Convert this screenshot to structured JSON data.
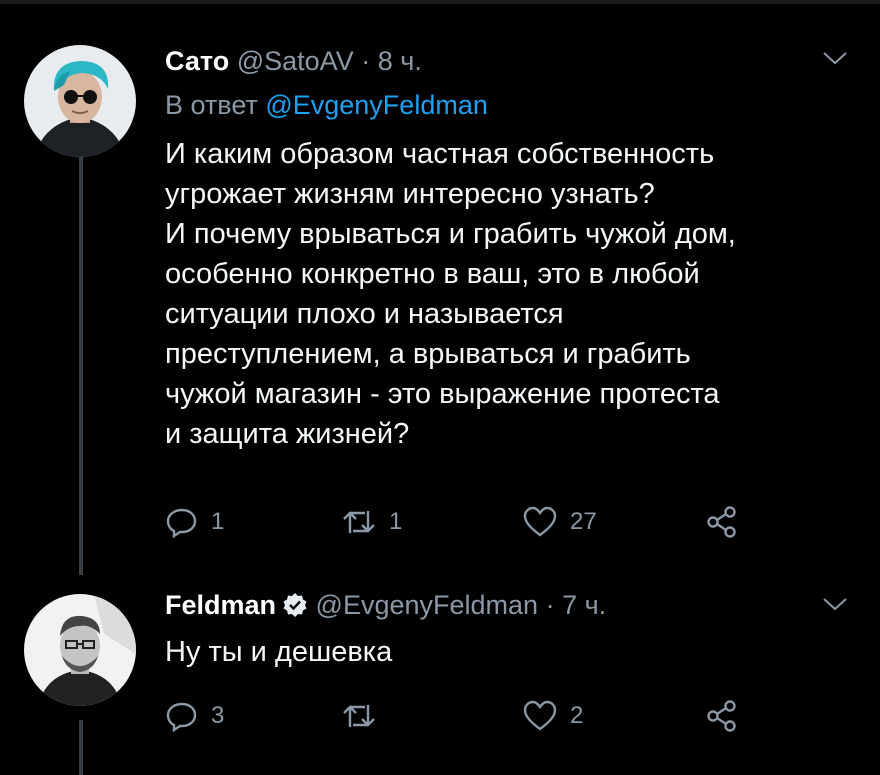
{
  "tweets": [
    {
      "name": "Сато",
      "handle": "@SatoAV",
      "dot": "·",
      "time": "8 ч.",
      "reply_prefix": "В ответ",
      "reply_mention": "@EvgenyFeldman",
      "text_lines": [
        "И каким образом частная собственность",
        "угрожает жизням интересно узнать?",
        "И почему врываться и грабить чужой дом,",
        "особенно конкретно в ваш, это в любой",
        "ситуации плохо и называется",
        "преступлением, а врываться и грабить",
        "чужой магазин - это выражение протеста",
        "и защита жизней?"
      ],
      "replies": "1",
      "retweets": "1",
      "likes": "27"
    },
    {
      "name": "Feldman",
      "verified": true,
      "handle": "@EvgenyFeldman",
      "dot": "·",
      "time": "7 ч.",
      "text_lines": [
        "Ну ты и дешевка"
      ],
      "replies": "3",
      "retweets": "",
      "likes": "2"
    }
  ],
  "colors": {
    "background": "#000000",
    "text": "#f5f8fa",
    "muted": "#8b98a5",
    "link": "#1da1f2",
    "thread_line": "#3a3f44"
  },
  "icons": [
    "reply-icon",
    "retweet-icon",
    "like-icon",
    "share-icon",
    "chevron-down-icon",
    "verified-icon"
  ]
}
